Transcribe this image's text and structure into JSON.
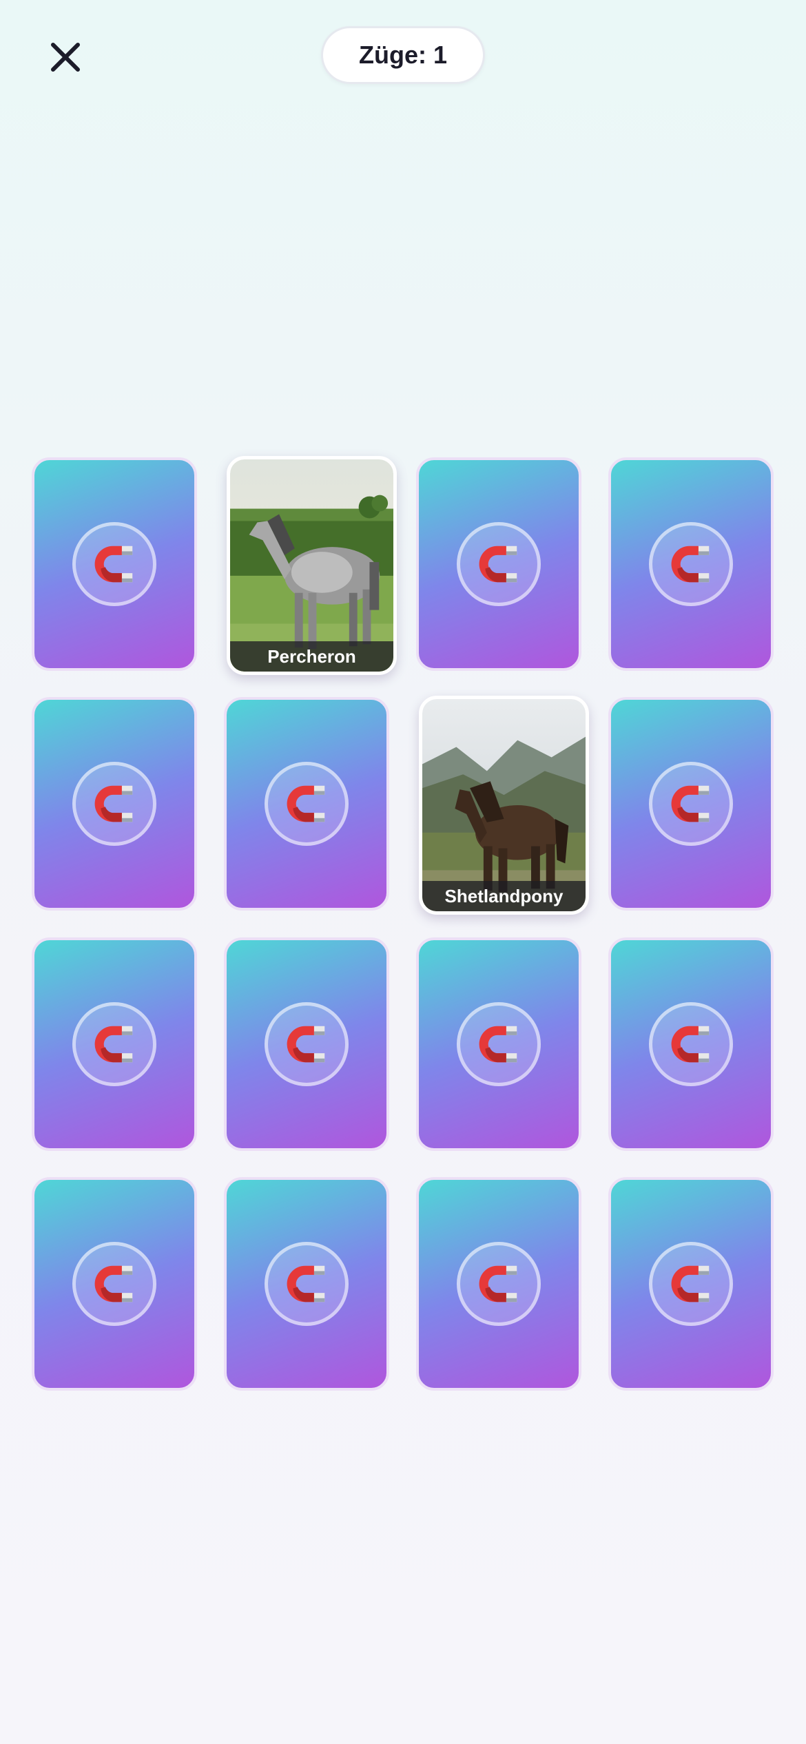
{
  "header": {
    "close_icon": "close-icon",
    "moves_label": "Züge: 1"
  },
  "board": {
    "card_back_icon": "magnet-icon",
    "card_back_colors": [
      "#4fd6d6",
      "#7f86ea",
      "#b056dd"
    ],
    "cards": [
      {
        "state": "hidden"
      },
      {
        "state": "revealed",
        "label": "Percheron",
        "image": "dapple-grey-horse-photo"
      },
      {
        "state": "hidden"
      },
      {
        "state": "hidden"
      },
      {
        "state": "hidden"
      },
      {
        "state": "hidden"
      },
      {
        "state": "revealed",
        "label": "Shetlandpony",
        "image": "brown-pony-photo"
      },
      {
        "state": "hidden"
      },
      {
        "state": "hidden"
      },
      {
        "state": "hidden"
      },
      {
        "state": "hidden"
      },
      {
        "state": "hidden"
      },
      {
        "state": "hidden"
      },
      {
        "state": "hidden"
      },
      {
        "state": "hidden"
      },
      {
        "state": "hidden"
      }
    ]
  }
}
